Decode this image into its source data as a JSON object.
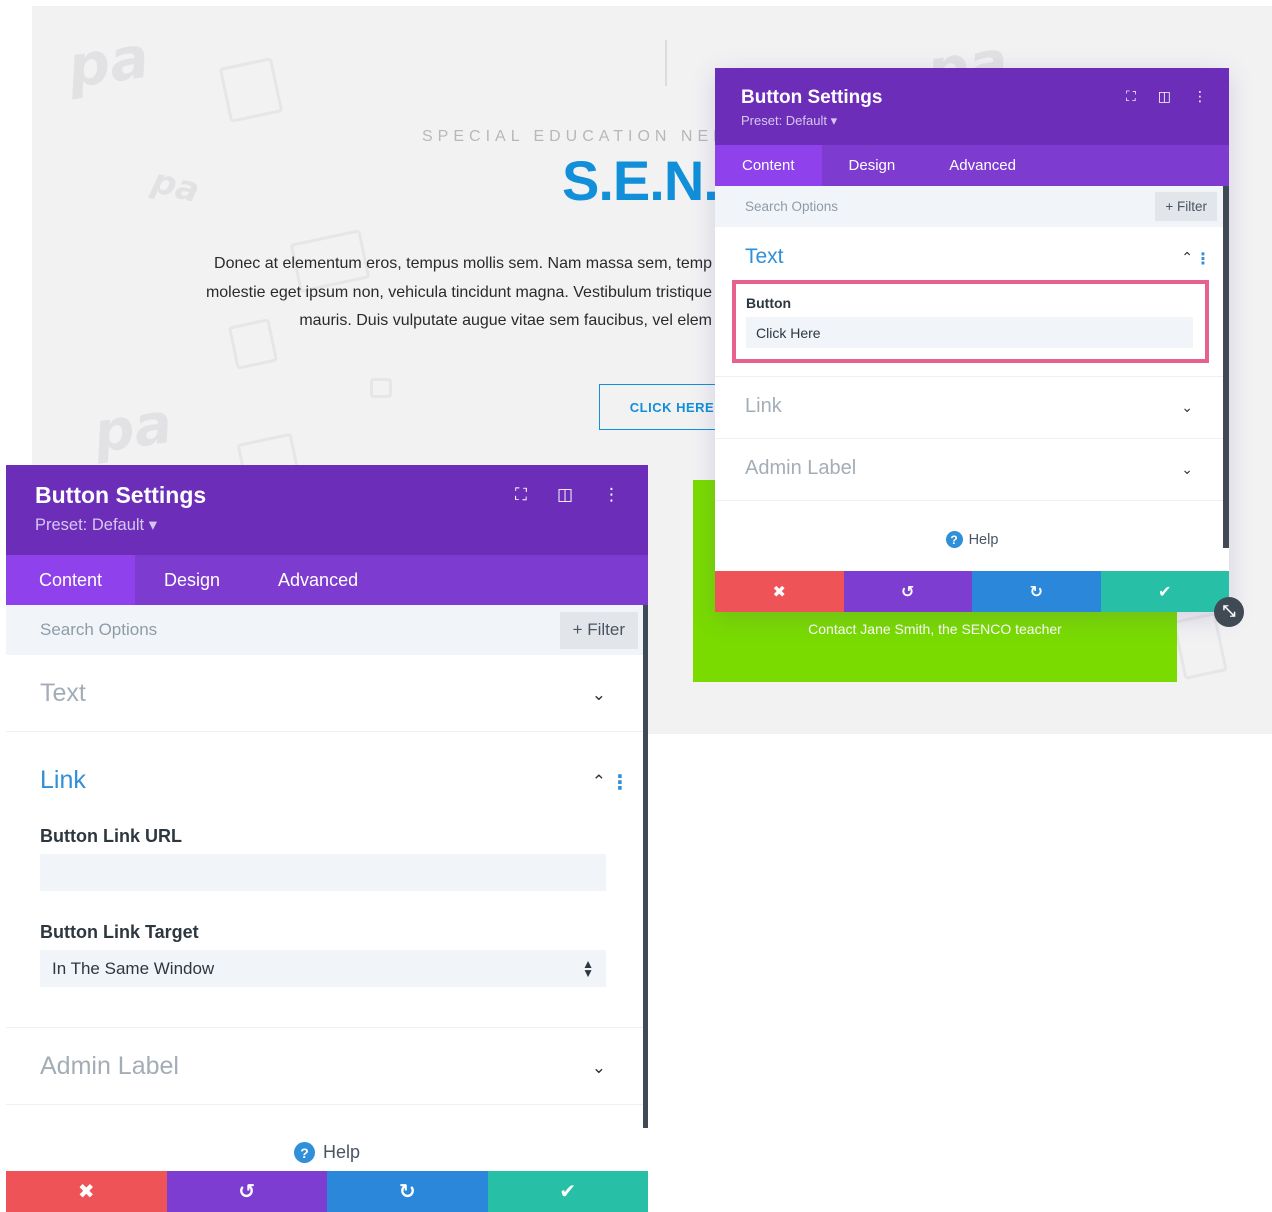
{
  "page": {
    "eyebrow": "SPECIAL EDUCATION NEED",
    "headline": "S.E.N.",
    "body_lines": [
      "Donec at elementum eros, tempus mollis sem. Nam massa sem, temp",
      "molestie eget ipsum non, vehicula tincidunt magna. Vestibulum tristique",
      "mauris. Duis vulputate augue vitae sem faucibus, vel elem"
    ],
    "cta_label": "CLICK HERE",
    "contact_text": "Contact Jane Smith, the SENCO teacher",
    "watermark": "pa"
  },
  "settings_small": {
    "title": "Button Settings",
    "preset": "Preset: Default ▾",
    "tabs": [
      "Content",
      "Design",
      "Advanced"
    ],
    "search_placeholder": "Search Options",
    "filter_label": "+ Filter",
    "sections": {
      "text": "Text",
      "link": "Link",
      "admin": "Admin Label"
    },
    "button_field_label": "Button",
    "button_field_value": "Click Here",
    "help": "Help"
  },
  "settings_large": {
    "title": "Button Settings",
    "preset": "Preset: Default ▾",
    "tabs": [
      "Content",
      "Design",
      "Advanced"
    ],
    "search_placeholder": "Search Options",
    "filter_label": "+ Filter",
    "sections": {
      "text": "Text",
      "link": "Link",
      "admin": "Admin Label"
    },
    "link_url_label": "Button Link URL",
    "link_url_value": "",
    "link_target_label": "Button Link Target",
    "link_target_value": "In The Same Window",
    "help": "Help"
  },
  "icons": {
    "fullscreen": "⛶",
    "split": "◫",
    "kebab": "⋮",
    "chevron_up": "⌃",
    "chevron_down": "⌄",
    "cancel": "✖",
    "undo": "↺",
    "redo": "↻",
    "save": "✔",
    "help": "?",
    "resize": "⤡"
  },
  "colors": {
    "header": "#6c2eb9",
    "tabs": "#7e3bd0",
    "tab_active": "#8f42ec",
    "accent": "#2f8fd8",
    "highlight": "#e8618c",
    "headline": "#118fd9",
    "green_block": "#79db00",
    "cancel": "#ee5457",
    "undo": "#7c3dd0",
    "redo": "#2b87da",
    "save": "#27c0a7"
  }
}
